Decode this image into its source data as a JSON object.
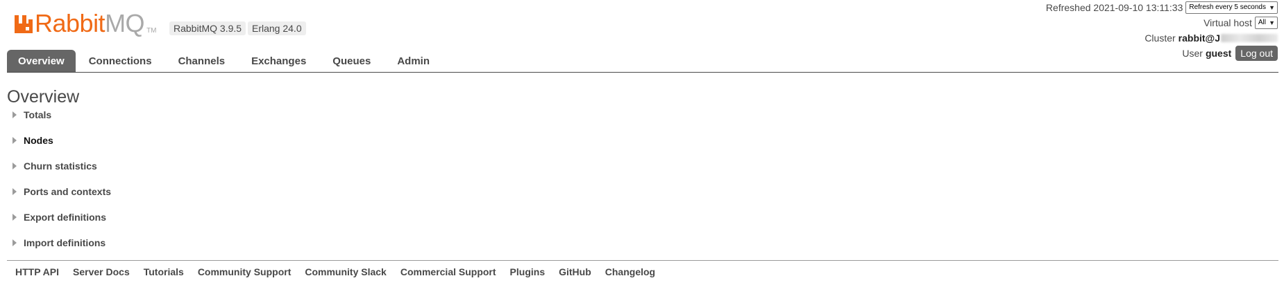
{
  "header": {
    "logo_rabbit": "Rabbit",
    "logo_mq": "MQ",
    "logo_tm": "TM",
    "rabbitmq_version": "RabbitMQ 3.9.5",
    "erlang_version": "Erlang 24.0",
    "refreshed_label": "Refreshed 2021-09-10 13:11:33",
    "refresh_select_value": "Refresh every 5 seconds",
    "virtual_host_label": "Virtual host",
    "virtual_host_value": "All",
    "cluster_label": "Cluster",
    "cluster_name_visible": "rabbit@J",
    "user_label": "User",
    "user_name": "guest",
    "logout_label": "Log out"
  },
  "tabs": [
    {
      "label": "Overview",
      "active": true
    },
    {
      "label": "Connections",
      "active": false
    },
    {
      "label": "Channels",
      "active": false
    },
    {
      "label": "Exchanges",
      "active": false
    },
    {
      "label": "Queues",
      "active": false
    },
    {
      "label": "Admin",
      "active": false
    }
  ],
  "main": {
    "title": "Overview",
    "sections": [
      {
        "label": "Totals"
      },
      {
        "label": "Nodes"
      },
      {
        "label": "Churn statistics"
      },
      {
        "label": "Ports and contexts"
      },
      {
        "label": "Export definitions"
      },
      {
        "label": "Import definitions"
      }
    ]
  },
  "footer": {
    "links": [
      "HTTP API",
      "Server Docs",
      "Tutorials",
      "Community Support",
      "Community Slack",
      "Commercial Support",
      "Plugins",
      "GitHub",
      "Changelog"
    ]
  },
  "colors": {
    "brand_orange": "#f06a16",
    "logo_gray": "#a9a9a9",
    "tab_active_bg": "#666666",
    "text": "#484848"
  }
}
